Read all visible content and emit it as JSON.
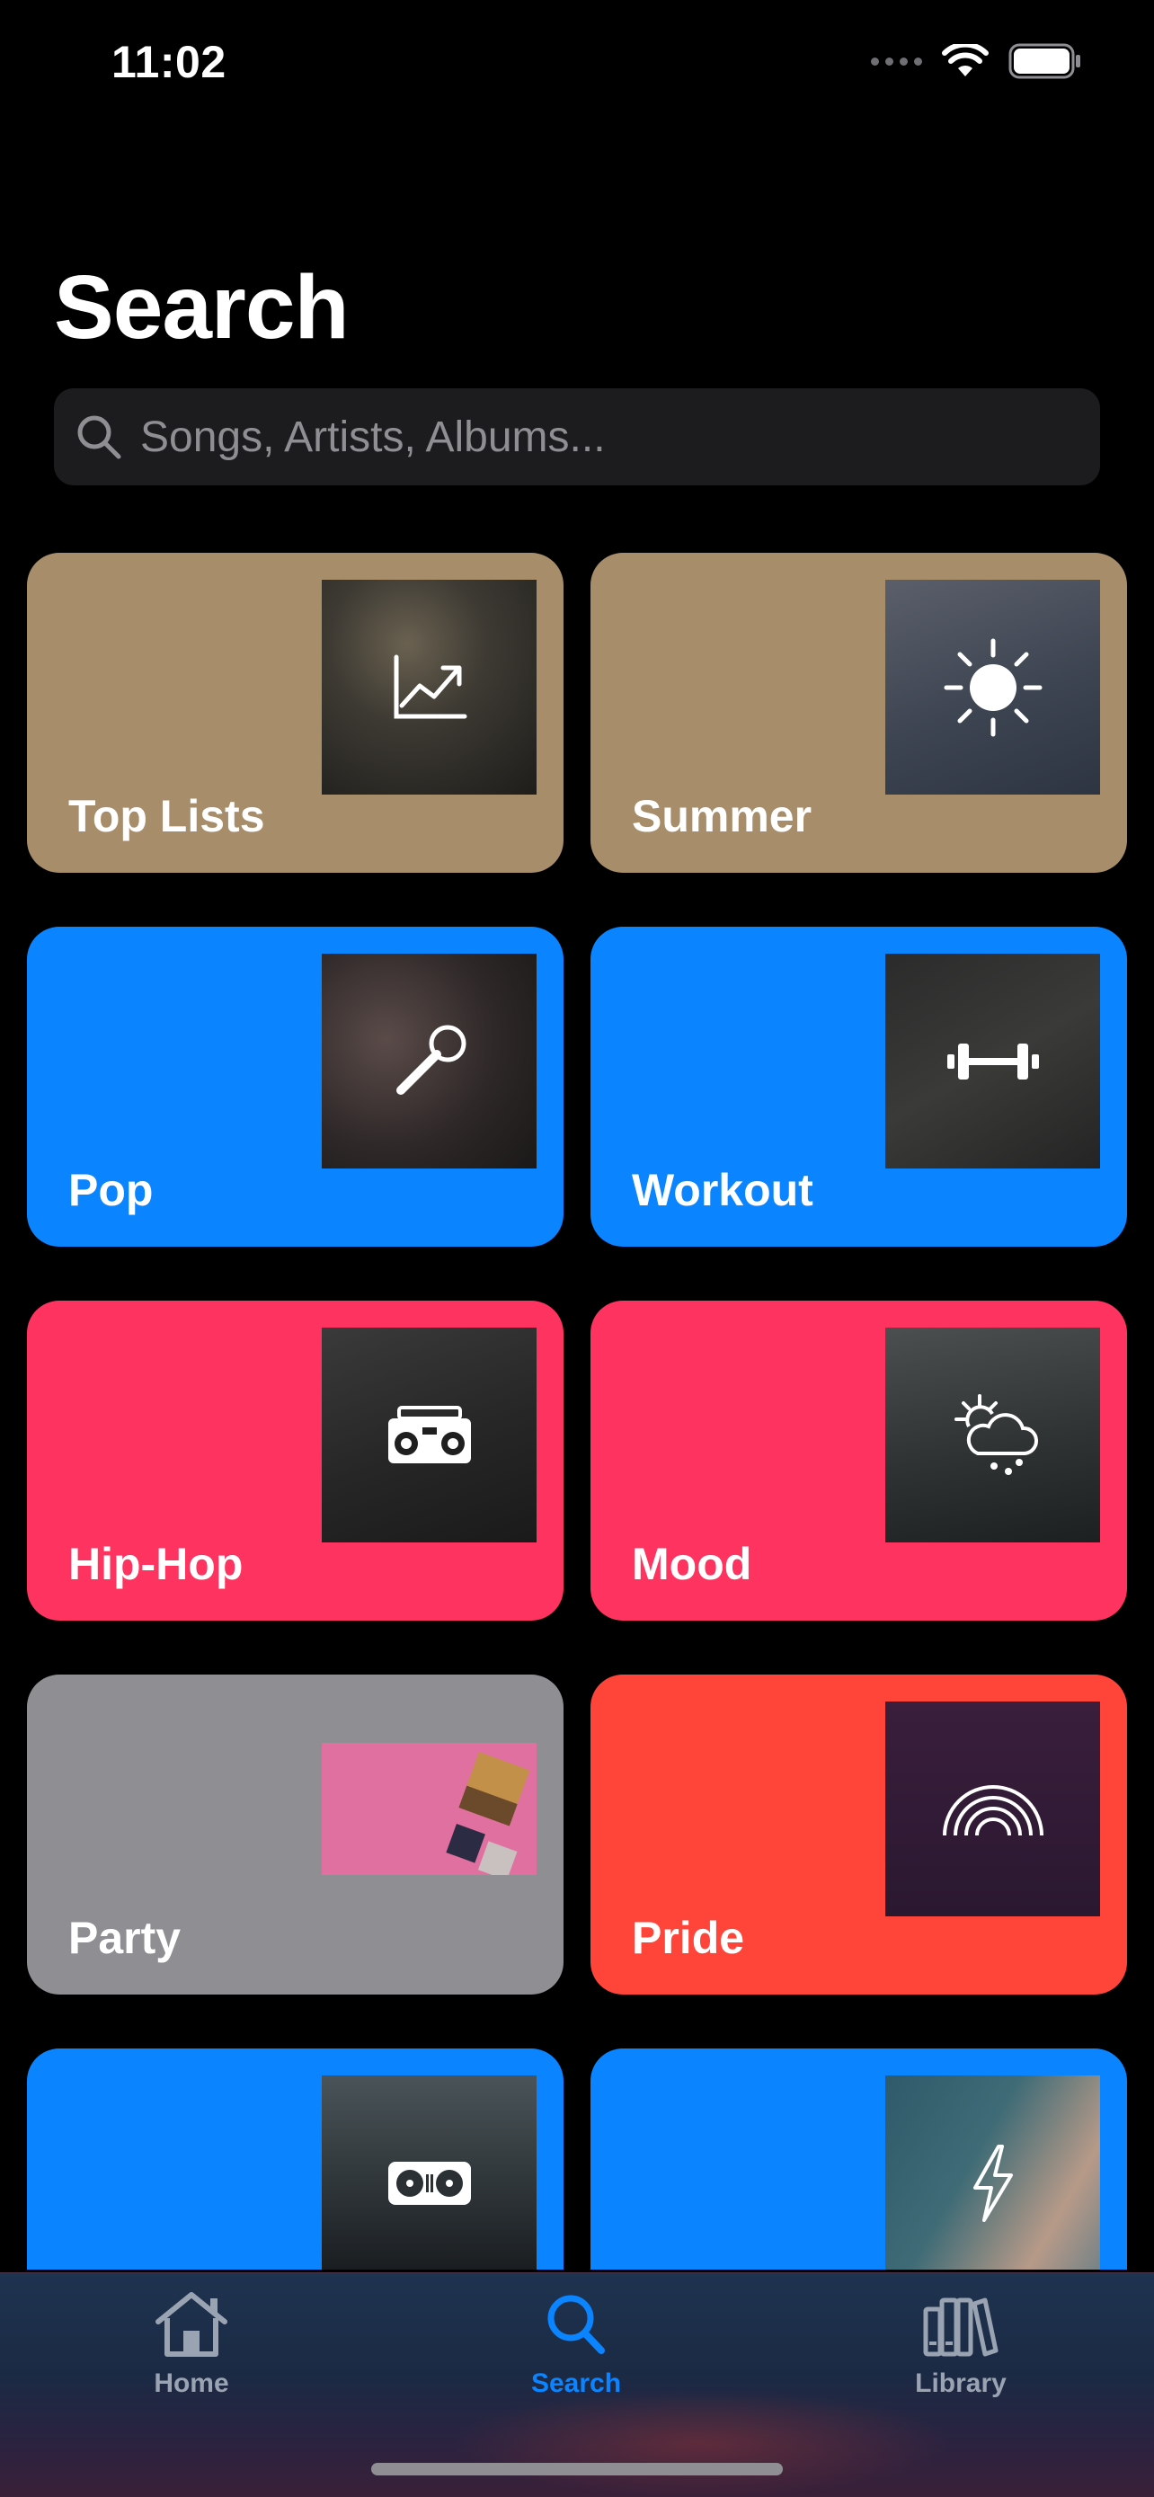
{
  "status": {
    "time": "11:02"
  },
  "header": {
    "title": "Search"
  },
  "search": {
    "placeholder": "Songs, Artists, Albums..."
  },
  "categories": [
    {
      "label": "Top Lists",
      "color": "#a88d6a",
      "icon": "chart-line-icon"
    },
    {
      "label": "Summer",
      "color": "#a88d6a",
      "icon": "sun-icon"
    },
    {
      "label": "Pop",
      "color": "#0a84ff",
      "icon": "microphone-icon"
    },
    {
      "label": "Workout",
      "color": "#0a84ff",
      "icon": "dumbbell-icon"
    },
    {
      "label": "Hip-Hop",
      "color": "#ff335f",
      "icon": "boombox-icon"
    },
    {
      "label": "Mood",
      "color": "#ff335f",
      "icon": "sun-cloud-rain-icon"
    },
    {
      "label": "Party",
      "color": "#8e8e93",
      "icon": "album-collage-icon"
    },
    {
      "label": "Pride",
      "color": "#ff453a",
      "icon": "rainbow-icon"
    },
    {
      "label": "",
      "color": "#0a84ff",
      "icon": "dj-turntable-icon"
    },
    {
      "label": "",
      "color": "#0a84ff",
      "icon": "lightning-icon"
    }
  ],
  "tabbar": {
    "home_label": "Home",
    "search_label": "Search",
    "library_label": "Library",
    "active": "Search",
    "accent": "#0a84ff"
  }
}
